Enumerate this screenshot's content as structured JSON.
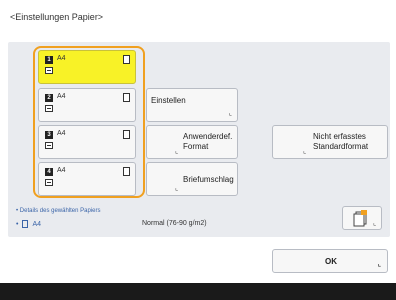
{
  "title": "<Einstellungen Papier>",
  "drawers": [
    {
      "num": "1",
      "size": "A4",
      "selected": true
    },
    {
      "num": "2",
      "size": "A4",
      "selected": false
    },
    {
      "num": "3",
      "size": "A4",
      "selected": false
    },
    {
      "num": "4",
      "size": "A4",
      "selected": false
    }
  ],
  "buttons": {
    "einstellen": "Einstellen",
    "custom_format_line1": "Anwenderdef.",
    "custom_format_line2": "Format",
    "unknown_format_line1": "Nicht erfasstes",
    "unknown_format_line2": "Standardformat",
    "envelope": "Briefumschlag",
    "ok": "OK"
  },
  "details": {
    "heading": "Details des gewählten Papiers",
    "size": "A4",
    "type": "Normal (76-90 g/m2)"
  },
  "colors": {
    "selected": "#f8f227",
    "highlight": "#f0a020"
  },
  "icons": {
    "paper": "paper-sheet-icon",
    "tray": "drawer-tray-icon",
    "settings": "paper-settings-icon",
    "corner": "corner-arrow-icon"
  }
}
